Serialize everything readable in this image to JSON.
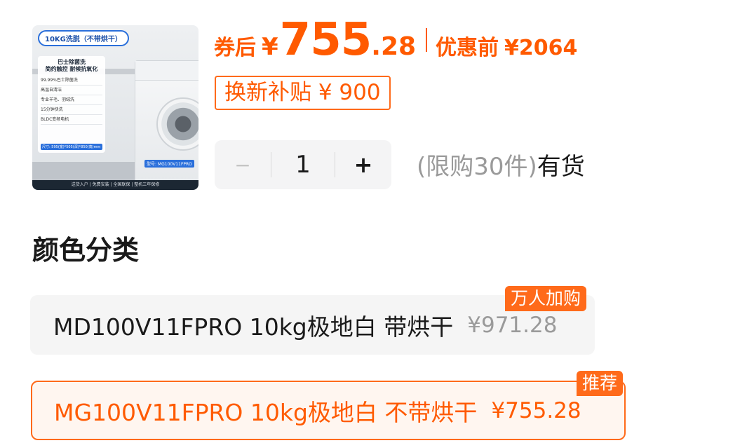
{
  "product": {
    "image": {
      "top_tag": "10KG洗脱（不带烘干）",
      "card_title": "巴士除菌洗\n简约触控 耐候抗氧化",
      "features": [
        "99.99%巴士除菌洗",
        "高温自清洁",
        "专业羊毛、羽绒洗",
        "15分钟快洗",
        "BLDC变频电机"
      ],
      "size_text": "尺寸: 595(宽)*505(深)*850(高)mm",
      "model_text": "型号: MG100V11FPRO",
      "footer_text": "送货入户 | 免费安装 | 全国联保 | 整机三年保修"
    }
  },
  "price": {
    "after_coupon_label": "券后",
    "currency": "¥",
    "integer": "755",
    "decimal": ".28",
    "before_label": "优惠前",
    "before_value": "¥2064",
    "subsidy_text": "换新补贴 ¥ 900"
  },
  "quantity": {
    "minus": "−",
    "value": "1",
    "plus": "+"
  },
  "stock": {
    "limit_text": "(限购30件)",
    "status": "有货"
  },
  "color_section": {
    "title": "颜色分类",
    "options": [
      {
        "name": "MD100V11FPRO 10kg极地白 带烘干",
        "price": "¥971.28",
        "badge": "万人加购",
        "selected": false
      },
      {
        "name": "MG100V11FPRO 10kg极地白 不带烘干",
        "price": "¥755.28",
        "badge": "推荐",
        "selected": true
      }
    ]
  },
  "colors": {
    "accent": "#ff5a00",
    "badge_bg": "#ff6a1a",
    "muted_text": "#9a9a9a"
  }
}
